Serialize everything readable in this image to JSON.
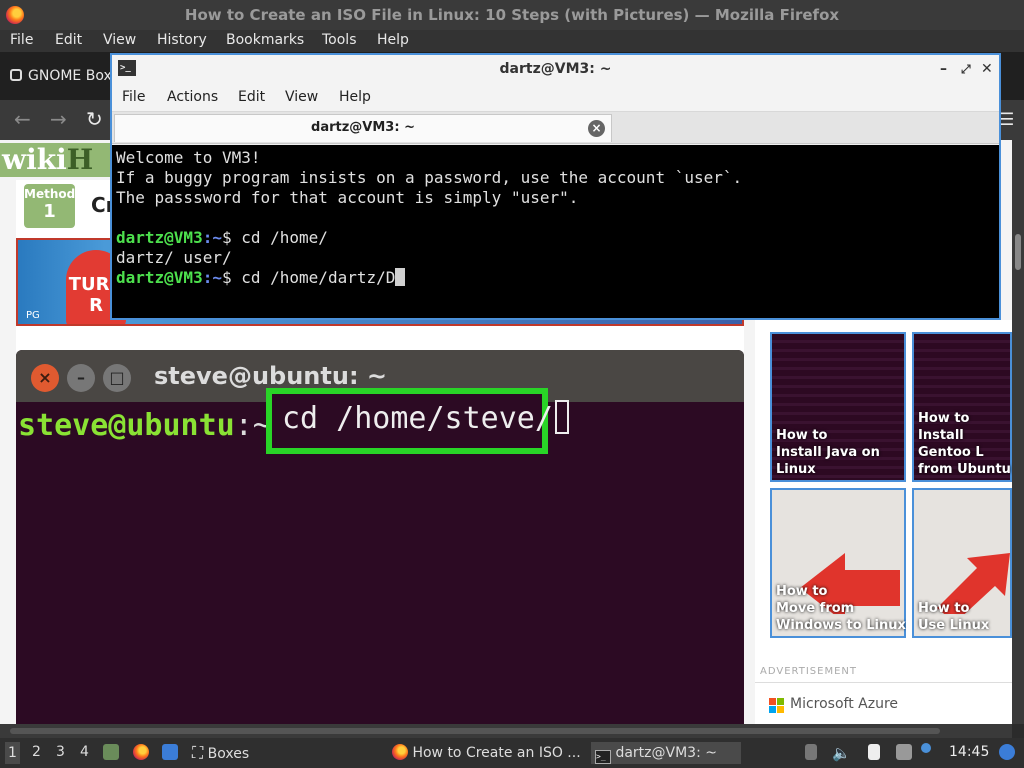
{
  "firefox": {
    "window_title": "How to Create an ISO File in Linux: 10 Steps (with Pictures) — Mozilla Firefox",
    "menu": [
      "File",
      "Edit",
      "View",
      "History",
      "Bookmarks",
      "Tools",
      "Help"
    ],
    "tab_label": "GNOME Box",
    "menu_icon": "hamburger-icon"
  },
  "page": {
    "logo_wiki": "wiki",
    "logo_h": "H",
    "method_label": "Method",
    "method_number": "1",
    "method_title": "Cr",
    "image1": {
      "badge": "PG",
      "text": "TURB R"
    },
    "image2": {
      "window_title": "steve@ubuntu: ~",
      "prompt": "steve@ubuntu",
      "prompt_suffix": ":~$",
      "command": "cd /home/steve/"
    },
    "related": [
      {
        "line1": "How to",
        "line2": "Install Java on",
        "line3": "Linux"
      },
      {
        "line1": "How to",
        "line2": "Install Gentoo L",
        "line3": "from Ubuntu"
      },
      {
        "line1": "How to",
        "line2": "Move from",
        "line3": "Windows to Linux"
      },
      {
        "line1": "How to",
        "line2": "Use Linux",
        "line3": ""
      }
    ],
    "advertisement_label": "ADVERTISEMENT",
    "ad_text": "Microsoft Azure"
  },
  "terminal": {
    "window_title": "dartz@VM3: ~",
    "menu": [
      "File",
      "Actions",
      "Edit",
      "View",
      "Help"
    ],
    "tab_title": "dartz@VM3: ~",
    "lines": [
      "Welcome to VM3!",
      "If a buggy program insists on a password, use the account `user`.",
      "The passsword for that account is simply \"user\"."
    ],
    "prompt_user": "dartz@VM3",
    "prompt_dir": ":~",
    "prompt_sym": "$",
    "cmd1": " cd /home/",
    "output1": "dartz/ user/",
    "cmd2": " cd /home/dartz/D"
  },
  "taskbar": {
    "workspaces": [
      "1",
      "2",
      "3",
      "4"
    ],
    "boxes_label": "Boxes",
    "task_firefox": "How to Create an ISO ...",
    "task_terminal": "dartz@VM3: ~",
    "clock": "14:45"
  }
}
